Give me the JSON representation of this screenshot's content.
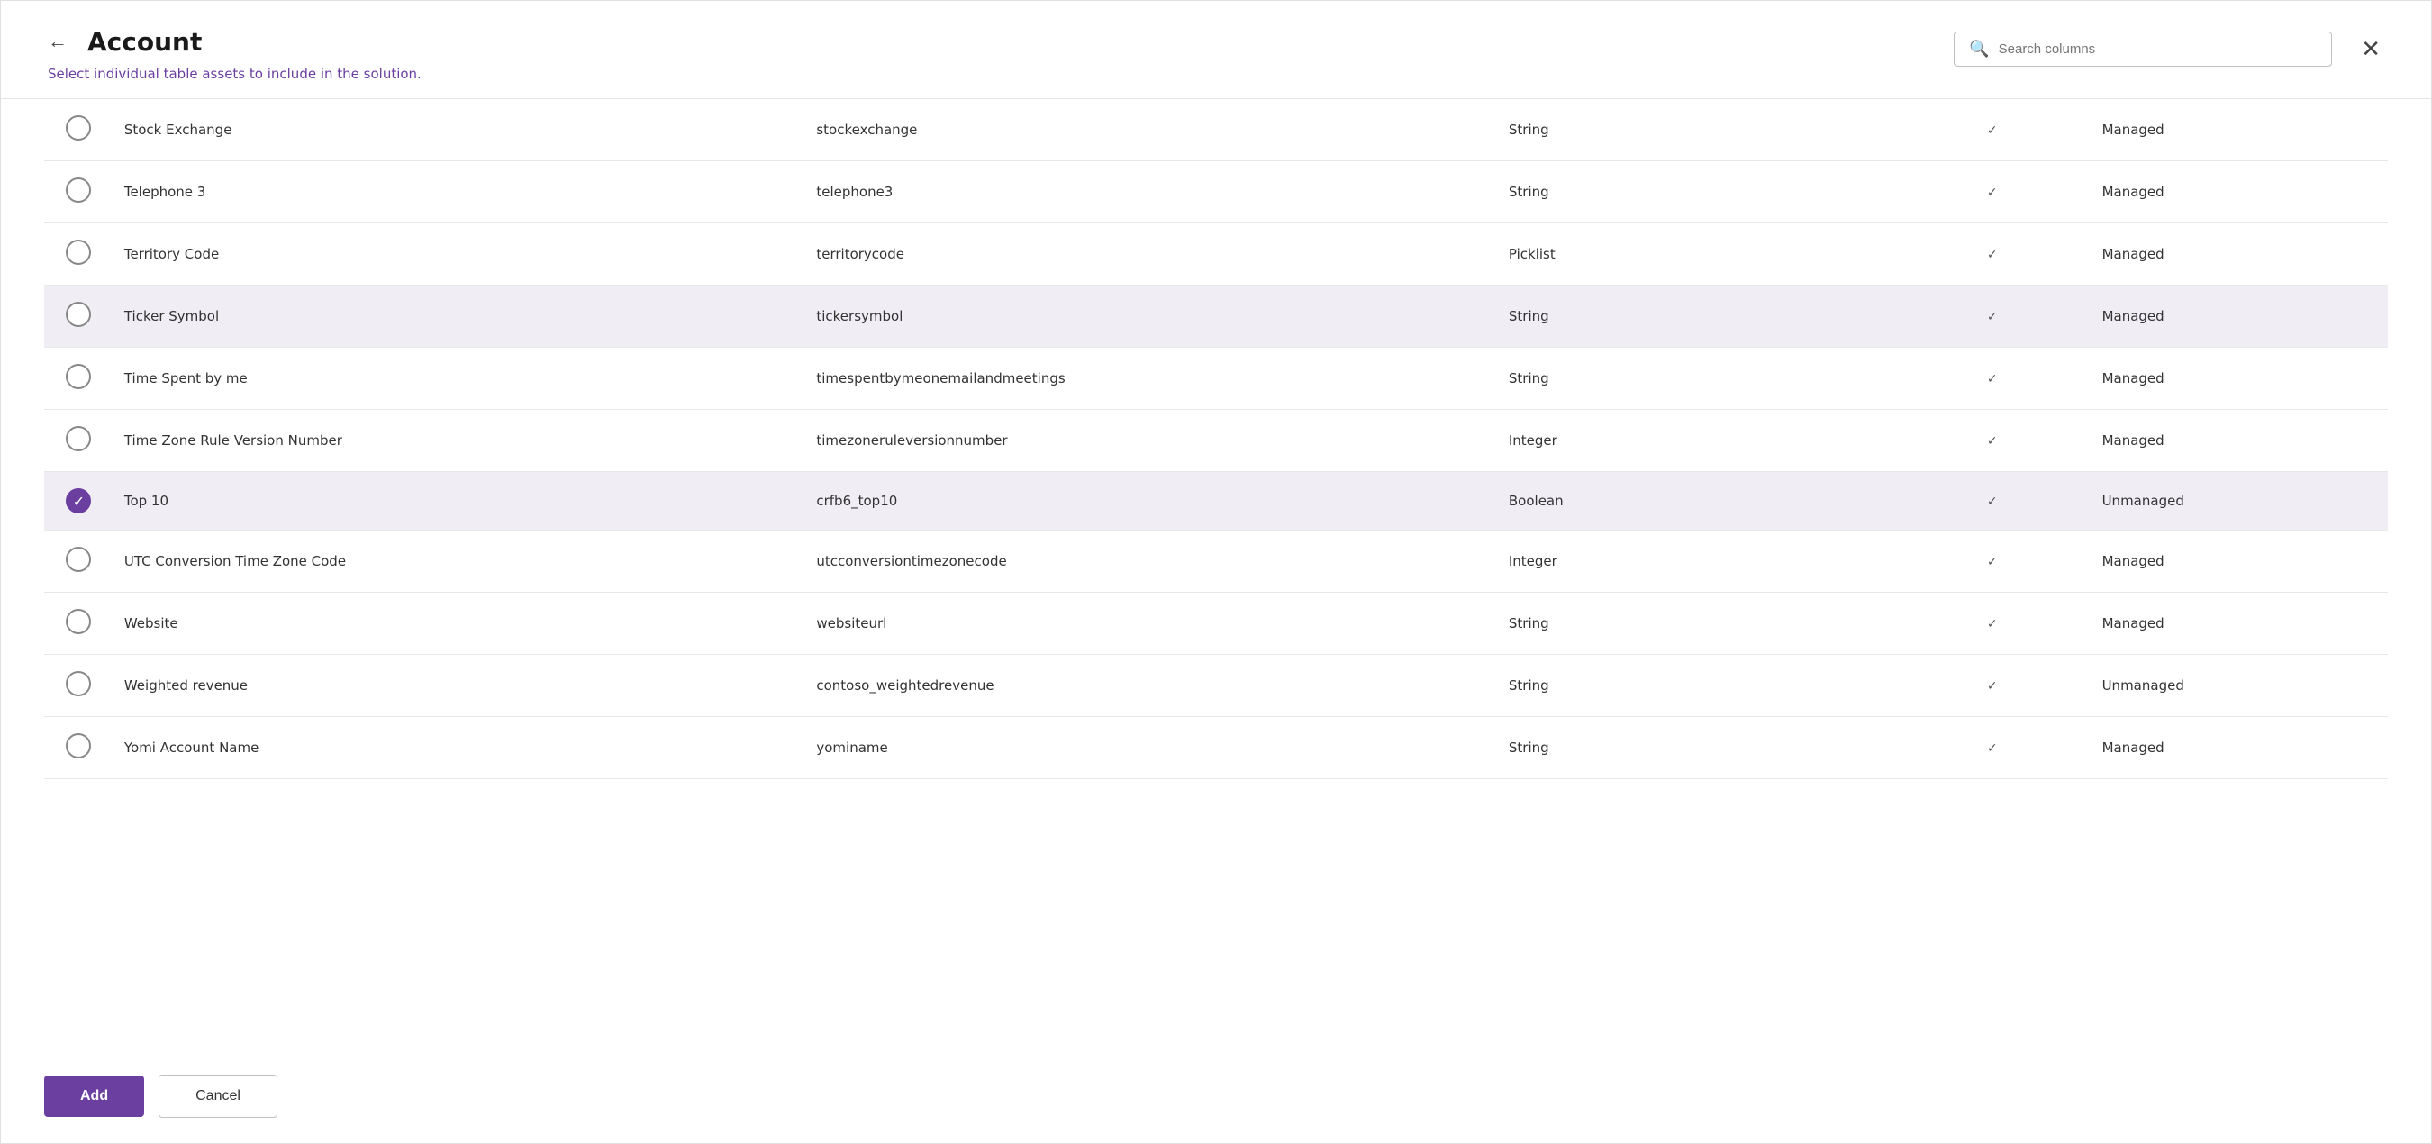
{
  "header": {
    "title": "Account",
    "subtitle_static": "Select ",
    "subtitle_highlight": "individual table assets",
    "subtitle_rest": " to include in the solution.",
    "search_placeholder": "Search columns",
    "close_label": "×"
  },
  "table": {
    "rows": [
      {
        "id": "stock-exchange",
        "name": "Stock Exchange",
        "logical": "stockexchange",
        "type": "String",
        "has_check": true,
        "managed": "Managed",
        "selected": false
      },
      {
        "id": "telephone-3",
        "name": "Telephone 3",
        "logical": "telephone3",
        "type": "String",
        "has_check": true,
        "managed": "Managed",
        "selected": false
      },
      {
        "id": "territory-code",
        "name": "Territory Code",
        "logical": "territorycode",
        "type": "Picklist",
        "has_check": true,
        "managed": "Managed",
        "selected": false
      },
      {
        "id": "ticker-symbol",
        "name": "Ticker Symbol",
        "logical": "tickersymbol",
        "type": "String",
        "has_check": true,
        "managed": "Managed",
        "selected": false,
        "highlighted": true
      },
      {
        "id": "time-spent",
        "name": "Time Spent by me",
        "logical": "timespentbymeonemailandmeetings",
        "type": "String",
        "has_check": true,
        "managed": "Managed",
        "selected": false
      },
      {
        "id": "timezone-rule",
        "name": "Time Zone Rule Version Number",
        "logical": "timezoneruleversionnumber",
        "type": "Integer",
        "has_check": true,
        "managed": "Managed",
        "selected": false
      },
      {
        "id": "top-10",
        "name": "Top 10",
        "logical": "crfb6_top10",
        "type": "Boolean",
        "has_check": true,
        "managed": "Unmanaged",
        "selected": true,
        "highlighted": true
      },
      {
        "id": "utc-conversion",
        "name": "UTC Conversion Time Zone Code",
        "logical": "utcconversiontimezonecode",
        "type": "Integer",
        "has_check": true,
        "managed": "Managed",
        "selected": false
      },
      {
        "id": "website",
        "name": "Website",
        "logical": "websiteurl",
        "type": "String",
        "has_check": true,
        "managed": "Managed",
        "selected": false
      },
      {
        "id": "weighted-revenue",
        "name": "Weighted revenue",
        "logical": "contoso_weightedrevenue",
        "type": "String",
        "has_check": true,
        "managed": "Unmanaged",
        "selected": false
      },
      {
        "id": "yomi-account",
        "name": "Yomi Account Name",
        "logical": "yominame",
        "type": "String",
        "has_check": true,
        "managed": "Managed",
        "selected": false
      }
    ]
  },
  "footer": {
    "add_label": "Add",
    "cancel_label": "Cancel"
  },
  "icons": {
    "back": "←",
    "close": "✕",
    "search": "🔍",
    "check": "✓",
    "checked_circle": "✓"
  }
}
